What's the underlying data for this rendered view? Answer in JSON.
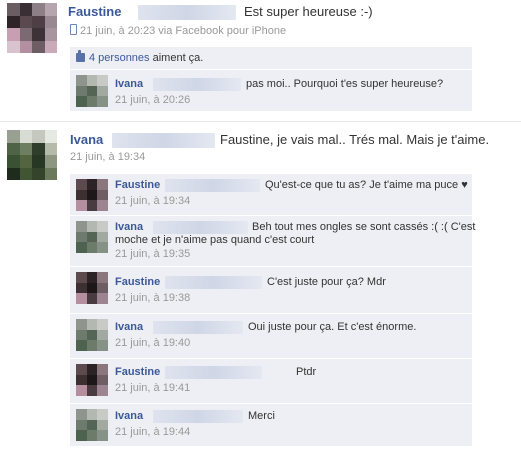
{
  "post1": {
    "author": "Faustine",
    "text": "Est super heureuse :-)",
    "time": "21 juin, à 20:23 via Facebook pour iPhone",
    "likes_count": "4 personnes",
    "likes_suffix": "aiment ça.",
    "comments": [
      {
        "author": "Ivana",
        "text": "pas moi.. Pourquoi t'es super heureuse?",
        "time": "21 juin, à 20:26"
      }
    ]
  },
  "post2": {
    "author": "Ivana",
    "text": "Faustine, je vais mal.. Trés mal. Mais je t'aime.",
    "time": "21 juin, à 19:34",
    "comments": [
      {
        "author": "Faustine",
        "text": "Qu'est-ce que tu as? Je t'aime ma puce ♥",
        "time": "21 juin, à 19:34"
      },
      {
        "author": "Ivana",
        "text": "Beh tout mes ongles se sont cassés :( :( C'est",
        "text2": "moche et je n'aime pas quand c'est court",
        "time": "21 juin, à 19:35"
      },
      {
        "author": "Faustine",
        "text": "C'est juste pour ça? Mdr",
        "time": "21 juin, à 19:38"
      },
      {
        "author": "Ivana",
        "text": "Oui juste pour ça. Et c'est énorme.",
        "time": "21 juin, à 19:40"
      },
      {
        "author": "Faustine",
        "text": "Ptdr",
        "time": "21 juin, à 19:41"
      },
      {
        "author": "Ivana",
        "text": "Merci",
        "time": "21 juin, à 19:44"
      }
    ]
  },
  "colors": {
    "link": "#3b5998",
    "comment_bg": "#edeff4",
    "meta": "#999999"
  }
}
